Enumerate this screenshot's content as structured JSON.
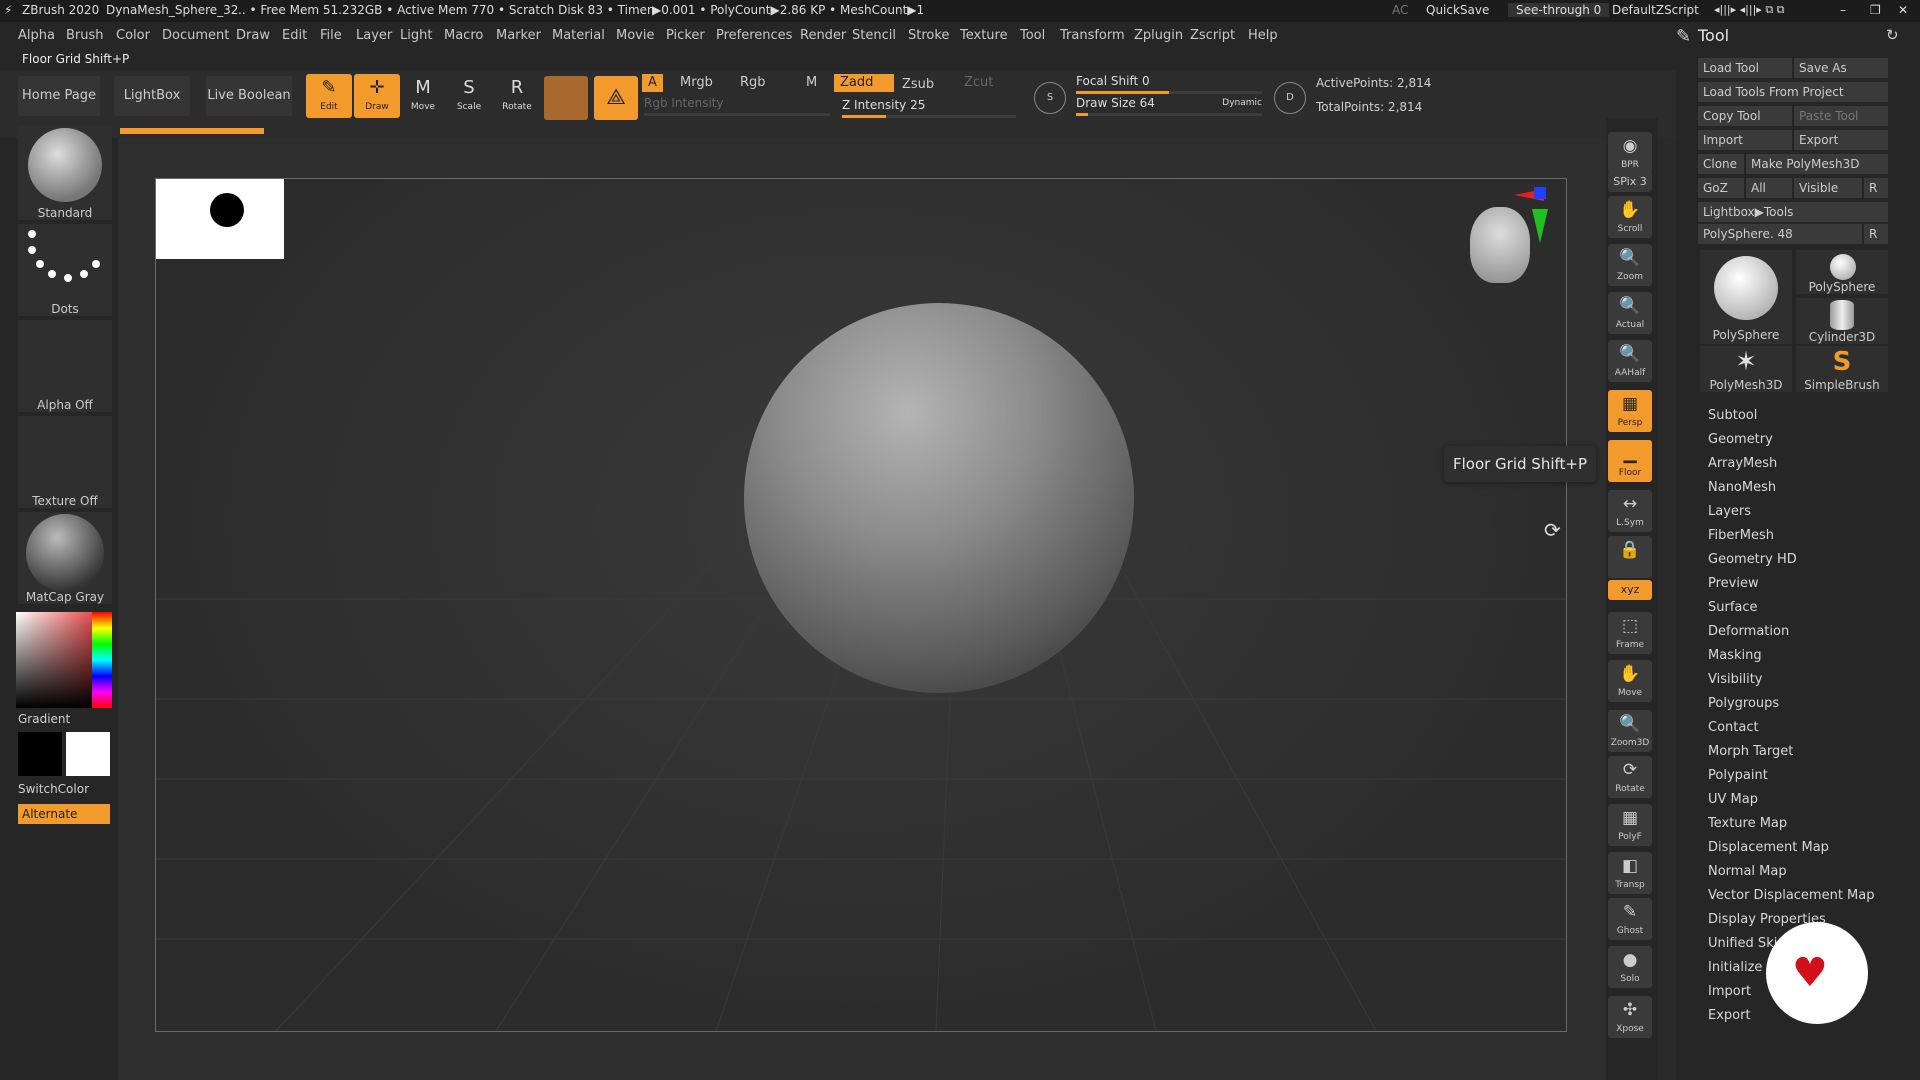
{
  "colors": {
    "accent": "#f39a2c",
    "bg": "#2a2a2a",
    "panel": "#262626",
    "button": "#353535"
  },
  "titlebar": {
    "app": "ZBrush 2020",
    "doc": "DynaMesh_Sphere_32",
    "stats": ".. • Free Mem 51.232GB • Active Mem 770 • Scratch Disk 83 • Timer▶0.001 • PolyCount▶2.86 KP • MeshCount▶1",
    "ac": "AC",
    "quicksave": "QuickSave",
    "seethrough": "See-through  0",
    "script": "DefaultZScript"
  },
  "menu": [
    "Alpha",
    "Brush",
    "Color",
    "Document",
    "Draw",
    "Edit",
    "File",
    "Layer",
    "Light",
    "Macro",
    "Marker",
    "Material",
    "Movie",
    "Picker",
    "Preferences",
    "Render",
    "Stencil",
    "Stroke",
    "Texture",
    "Tool",
    "Transform",
    "Zplugin",
    "Zscript",
    "Help"
  ],
  "subbar": {
    "hint": "Floor Grid Shift+P"
  },
  "shelf": {
    "home": "Home Page",
    "lightbox": "LightBox",
    "liveboolean": "Live Boolean",
    "tools": [
      {
        "label": "Edit",
        "glyph": "✎",
        "active": true
      },
      {
        "label": "Draw",
        "glyph": "✛",
        "active": true
      },
      {
        "label": "Move",
        "glyph": "M",
        "active": false
      },
      {
        "label": "Scale",
        "glyph": "S",
        "active": false
      },
      {
        "label": "Rotate",
        "glyph": "R",
        "active": false
      }
    ],
    "modes": {
      "a": "A",
      "mrgb": "Mrgb",
      "rgb": "Rgb",
      "m": "M",
      "zadd": "Zadd",
      "zsub": "Zsub",
      "zcut": "Zcut"
    },
    "rgb_intensity": "Rgb Intensity",
    "z_intensity": "Z Intensity 25",
    "focal_shift": "Focal Shift 0",
    "draw_size": "Draw Size 64",
    "dynamic": "Dynamic",
    "active_points": "ActivePoints: 2,814",
    "total_points": "TotalPoints: 2,814",
    "z_intensity_value": 25,
    "focal_shift_value": 0,
    "draw_size_value": 64
  },
  "left": {
    "brush": "Standard",
    "stroke": "Dots",
    "alpha": "Alpha Off",
    "texture": "Texture Off",
    "material": "MatCap Gray",
    "gradient": "Gradient",
    "switchcolor": "SwitchColor",
    "alternate": "Alternate"
  },
  "right_tools": [
    {
      "label": "BPR",
      "glyph": "◉",
      "active": false
    },
    {
      "label": "SPix 3",
      "glyph": "",
      "active": false
    },
    {
      "label": "Scroll",
      "glyph": "✋",
      "active": false
    },
    {
      "label": "Zoom",
      "glyph": "🔍",
      "active": false
    },
    {
      "label": "Actual",
      "glyph": "🔍",
      "active": false
    },
    {
      "label": "AAHalf",
      "glyph": "🔍",
      "active": false
    },
    {
      "label": "Persp",
      "glyph": "▦",
      "active": true
    },
    {
      "label": "Floor",
      "glyph": "▁",
      "active": true
    },
    {
      "label": "L.Sym",
      "glyph": "↔",
      "active": false
    },
    {
      "label": "",
      "glyph": "🔒",
      "active": false
    },
    {
      "label": "xyz",
      "glyph": "",
      "active": true
    },
    {
      "label": "Frame",
      "glyph": "⬚",
      "active": false
    },
    {
      "label": "Move",
      "glyph": "✋",
      "active": false
    },
    {
      "label": "Zoom3D",
      "glyph": "🔍",
      "active": false
    },
    {
      "label": "Rotate",
      "glyph": "⟳",
      "active": false
    },
    {
      "label": "PolyF",
      "glyph": "▦",
      "active": false
    },
    {
      "label": "Transp",
      "glyph": "◧",
      "active": false
    },
    {
      "label": "Ghost",
      "glyph": "✎",
      "active": false
    },
    {
      "label": "Solo",
      "glyph": "●",
      "active": false
    },
    {
      "label": "Xpose",
      "glyph": "✣",
      "active": false
    }
  ],
  "tooltip": "Floor Grid  Shift+P",
  "toolpanel": {
    "title": "Tool",
    "load_tool": "Load Tool",
    "save_as": "Save As",
    "load_from_project": "Load Tools From Project",
    "copy_tool": "Copy Tool",
    "paste_tool": "Paste Tool",
    "import": "Import",
    "export": "Export",
    "clone": "Clone",
    "make_polymesh": "Make PolyMesh3D",
    "goz": "GoZ",
    "all": "All",
    "visible": "Visible",
    "r": "R",
    "lightbox_tools": "Lightbox▶Tools",
    "polysphere_slider": "PolySphere. 48",
    "thumbs": [
      "PolySphere",
      "PolySphere",
      "Cylinder3D",
      "PolyMesh3D",
      "SimpleBrush"
    ],
    "sections": [
      "Subtool",
      "Geometry",
      "ArrayMesh",
      "NanoMesh",
      "Layers",
      "FiberMesh",
      "Geometry HD",
      "Preview",
      "Surface",
      "Deformation",
      "Masking",
      "Visibility",
      "Polygroups",
      "Contact",
      "Morph Target",
      "Polypaint",
      "UV Map",
      "Texture Map",
      "Displacement Map",
      "Normal Map",
      "Vector Displacement Map",
      "Display Properties",
      "Unified Skin",
      "Initialize",
      "Import",
      "Export"
    ]
  }
}
